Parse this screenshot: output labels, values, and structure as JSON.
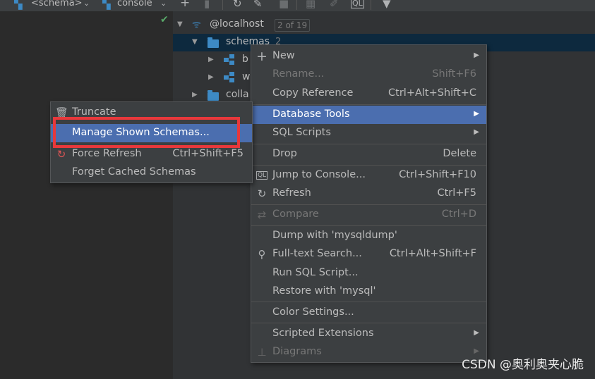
{
  "toolbar": {
    "schema_label": "<schema>",
    "console_label": "console"
  },
  "tree": {
    "root_label": "@localhost",
    "root_badge": "2 of 19",
    "schemas_label": "schemas",
    "schemas_count": "2",
    "child1_label": "b",
    "child2_label": "w",
    "collations_label": "colla"
  },
  "left_menu": {
    "items": [
      {
        "label": "Truncate",
        "shortcut": ""
      },
      {
        "label": "Manage Shown Schemas...",
        "shortcut": ""
      },
      {
        "label": "Force Refresh",
        "shortcut": "Ctrl+Shift+F5"
      },
      {
        "label": "Forget Cached Schemas",
        "shortcut": ""
      }
    ]
  },
  "context_menu": {
    "items": [
      {
        "label": "New",
        "shortcut": ""
      },
      {
        "label": "Rename...",
        "shortcut": "Shift+F6"
      },
      {
        "label": "Copy Reference",
        "shortcut": "Ctrl+Alt+Shift+C"
      },
      {
        "label": "Database Tools",
        "shortcut": ""
      },
      {
        "label": "SQL Scripts",
        "shortcut": ""
      },
      {
        "label": "Drop",
        "shortcut": "Delete"
      },
      {
        "label": "Jump to Console...",
        "shortcut": "Ctrl+Shift+F10"
      },
      {
        "label": "Refresh",
        "shortcut": "Ctrl+F5"
      },
      {
        "label": "Compare",
        "shortcut": "Ctrl+D"
      },
      {
        "label": "Dump with 'mysqldump'",
        "shortcut": ""
      },
      {
        "label": "Full-text Search...",
        "shortcut": "Ctrl+Alt+Shift+F"
      },
      {
        "label": "Run SQL Script...",
        "shortcut": ""
      },
      {
        "label": "Restore with 'mysql'",
        "shortcut": ""
      },
      {
        "label": "Color Settings...",
        "shortcut": ""
      },
      {
        "label": "Scripted Extensions",
        "shortcut": ""
      },
      {
        "label": "Diagrams",
        "shortcut": ""
      }
    ]
  },
  "watermark": "CSDN @奥利奥夹心脆",
  "colors": {
    "selection": "#4b6eaf",
    "highlight_box": "#e8383b",
    "folder": "#3d8ac5",
    "check": "#59a869"
  }
}
